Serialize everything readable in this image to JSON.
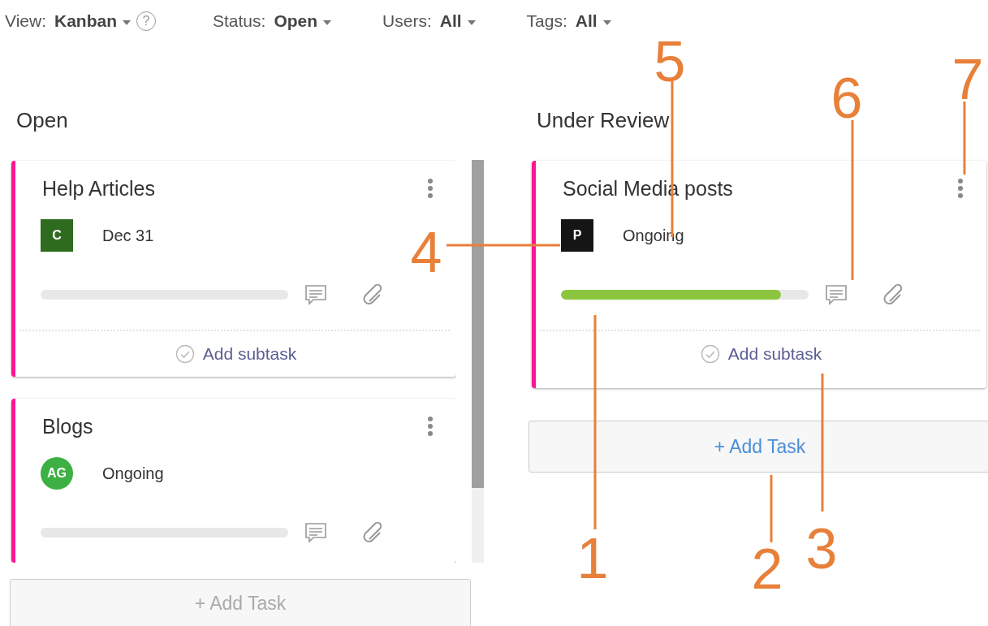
{
  "filters": [
    {
      "label": "View:",
      "value": "Kanban",
      "help": "?"
    },
    {
      "label": "Status:",
      "value": "Open"
    },
    {
      "label": "Users:",
      "value": "All"
    },
    {
      "label": "Tags:",
      "value": "All"
    }
  ],
  "columns": [
    {
      "title": "Open",
      "cards": [
        {
          "title": "Help Articles",
          "avatar": {
            "initials": "C",
            "kind": "square",
            "color": "#2e6b1e"
          },
          "meta": "Dec 31",
          "level": 0,
          "subtask": "Add subtask"
        },
        {
          "title": "Blogs",
          "avatar": {
            "initials": "AG",
            "kind": "circle",
            "color": "#3cb043"
          },
          "meta": "Ongoing",
          "level": 0
        }
      ],
      "add_task": {
        "label": "+ Add Task",
        "disabled": true
      }
    },
    {
      "title": "Under Review",
      "cards": [
        {
          "title": "Social Media posts",
          "avatar": {
            "initials": "P",
            "kind": "square",
            "color": "#151515"
          },
          "meta": "Ongoing",
          "level": 0.89,
          "subtask": "Add subtask"
        }
      ],
      "add_task": {
        "label": "+ Add Task",
        "disabled": false
      }
    }
  ],
  "annotations": [
    {
      "label": "1"
    },
    {
      "label": "2"
    },
    {
      "label": "3"
    },
    {
      "label": "4"
    },
    {
      "label": "5"
    },
    {
      "label": "6"
    },
    {
      "label": "7"
    }
  ]
}
